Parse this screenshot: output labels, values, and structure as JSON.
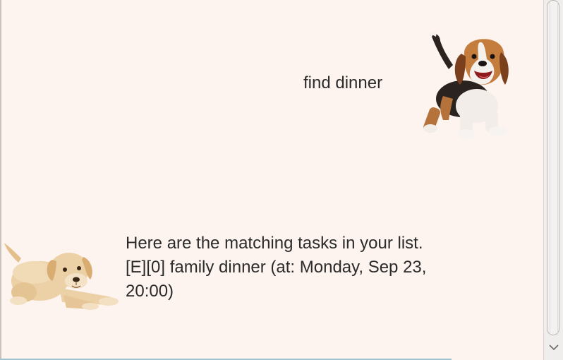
{
  "dialog": {
    "user_message": "find dinner",
    "bot_message_lines": [
      "Here are the matching tasks in your list.",
      "[E][0] family dinner (at: Monday, Sep 23,",
      "20:00)"
    ]
  },
  "avatars": {
    "user": "beagle-puppy-avatar",
    "bot": "labrador-puppy-avatar"
  },
  "colors": {
    "background": "#fdf4ef",
    "text": "#2b2b2b"
  }
}
